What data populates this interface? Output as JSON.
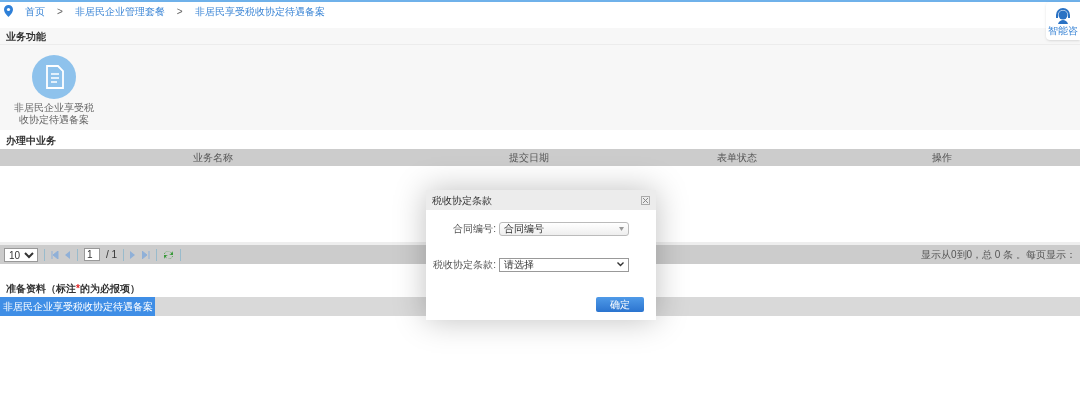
{
  "breadcrumb": [
    {
      "label": "首页"
    },
    {
      "label": "非居民企业管理套餐"
    },
    {
      "label": "非居民享受税收协定待遇备案"
    }
  ],
  "breadcrumb_separator": ">",
  "help_widget": {
    "label": "智能咨"
  },
  "functions": {
    "title": "业务功能",
    "items": [
      {
        "label": "非居民企业享受税收协定待遇备案"
      }
    ]
  },
  "in_progress": {
    "title": "办理中业务",
    "columns": [
      "业务名称",
      "提交日期",
      "表单状态",
      "操作"
    ]
  },
  "pager": {
    "page_size": "10",
    "page": "1",
    "total_pages": "/ 1",
    "summary": "显示从0到0，总 0 条 。每页显示："
  },
  "materials": {
    "title_before": "准备资料（标注",
    "required_mark": "*",
    "title_after": "的为必报项）",
    "tabs": [
      {
        "label": "非居民企业享受税收协定待遇备案",
        "selected": true
      }
    ]
  },
  "dialog": {
    "title": "税收协定条款",
    "fields": [
      {
        "label": "合同编号:",
        "value": "合同编号",
        "disabled": true
      },
      {
        "label": "税收协定条款:",
        "value": "请选择",
        "disabled": false
      }
    ],
    "confirm": "确定"
  }
}
